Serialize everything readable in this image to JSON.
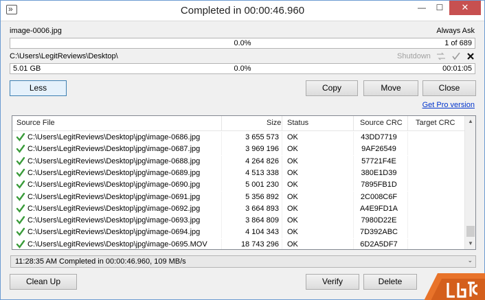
{
  "window": {
    "title": "Completed in 00:00:46.960",
    "close_glyph": "✕",
    "min_glyph": "—",
    "max_glyph": "☐"
  },
  "file_progress": {
    "filename": "image-0006.jpg",
    "mode": "Always Ask",
    "percent": "0.0%",
    "count": "1 of 689"
  },
  "total_progress": {
    "path": "C:\\Users\\LegitReviews\\Desktop\\",
    "shutdown": "Shutdown",
    "size": "5.01 GB",
    "percent": "0.0%",
    "elapsed": "00:01:05"
  },
  "buttons": {
    "less": "Less",
    "copy": "Copy",
    "move": "Move",
    "close": "Close",
    "pro": "Get Pro version",
    "clean_up": "Clean Up",
    "verify": "Verify",
    "delete": "Delete"
  },
  "columns": {
    "source": "Source File",
    "size": "Size",
    "status": "Status",
    "source_crc": "Source CRC",
    "target_crc": "Target CRC"
  },
  "rows": [
    {
      "file": "C:\\Users\\LegitReviews\\Desktop\\jpg\\image-0686.jpg",
      "size": "3 655 573",
      "status": "OK",
      "crc": "43DD7719"
    },
    {
      "file": "C:\\Users\\LegitReviews\\Desktop\\jpg\\image-0687.jpg",
      "size": "3 969 196",
      "status": "OK",
      "crc": "9AF26549"
    },
    {
      "file": "C:\\Users\\LegitReviews\\Desktop\\jpg\\image-0688.jpg",
      "size": "4 264 826",
      "status": "OK",
      "crc": "57721F4E"
    },
    {
      "file": "C:\\Users\\LegitReviews\\Desktop\\jpg\\image-0689.jpg",
      "size": "4 513 338",
      "status": "OK",
      "crc": "380E1D39"
    },
    {
      "file": "C:\\Users\\LegitReviews\\Desktop\\jpg\\image-0690.jpg",
      "size": "5 001 230",
      "status": "OK",
      "crc": "7895FB1D"
    },
    {
      "file": "C:\\Users\\LegitReviews\\Desktop\\jpg\\image-0691.jpg",
      "size": "5 356 892",
      "status": "OK",
      "crc": "2C008C6F"
    },
    {
      "file": "C:\\Users\\LegitReviews\\Desktop\\jpg\\image-0692.jpg",
      "size": "3 664 893",
      "status": "OK",
      "crc": "A4E9FD1A"
    },
    {
      "file": "C:\\Users\\LegitReviews\\Desktop\\jpg\\image-0693.jpg",
      "size": "3 864 809",
      "status": "OK",
      "crc": "7980D22E"
    },
    {
      "file": "C:\\Users\\LegitReviews\\Desktop\\jpg\\image-0694.jpg",
      "size": "4 104 343",
      "status": "OK",
      "crc": "7D392ABC"
    },
    {
      "file": "C:\\Users\\LegitReviews\\Desktop\\jpg\\image-0695.MOV",
      "size": "18 743 296",
      "status": "OK",
      "crc": "6D2A5DF7"
    }
  ],
  "status_line": "11:28:35 AM Completed in 00:00:46.960, 109 MB/s",
  "icons": {
    "check": "check-icon",
    "pause": "pause-icon",
    "cancel": "cancel-icon"
  },
  "colors": {
    "check_green": "#3a9b3a",
    "link_blue": "#0033cc",
    "logo_orange": "#e8732a"
  }
}
